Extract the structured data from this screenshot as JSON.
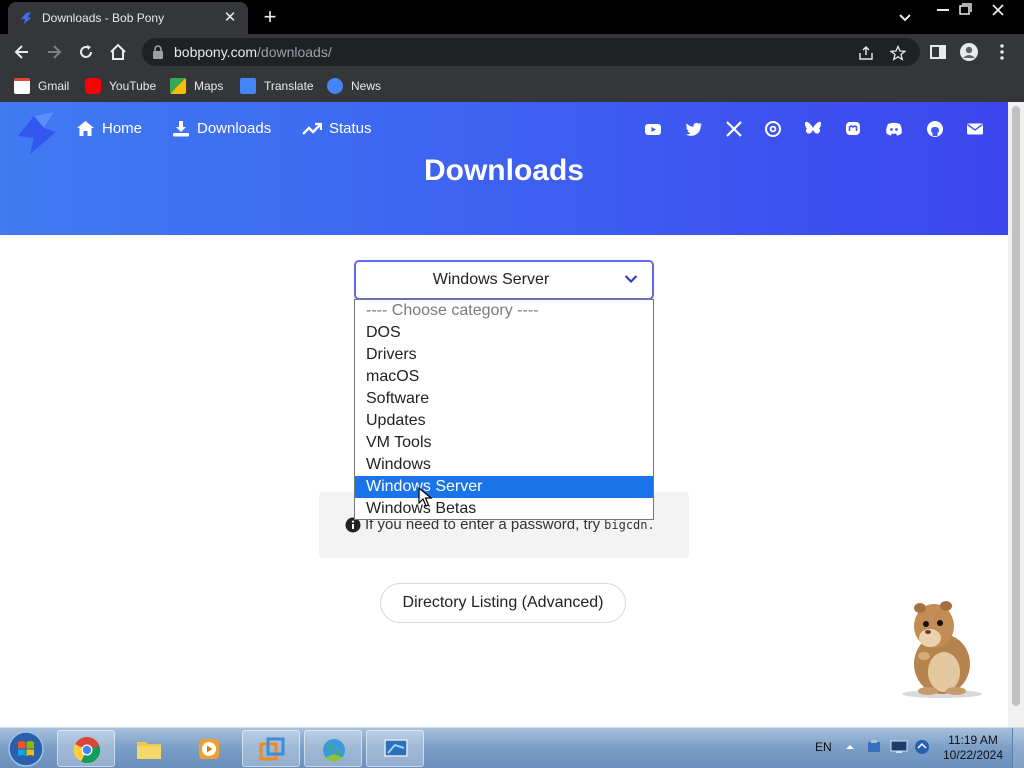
{
  "browser": {
    "tab_title": "Downloads - Bob Pony",
    "url_domain": "bobpony.com",
    "url_path": "/downloads/",
    "bookmarks": [
      "Gmail",
      "YouTube",
      "Maps",
      "Translate",
      "News"
    ]
  },
  "site": {
    "nav": {
      "home": "Home",
      "downloads": "Downloads",
      "status": "Status"
    },
    "social_icons": [
      "youtube-icon",
      "twitter-icon",
      "x-icon",
      "threads-icon",
      "bluesky-icon",
      "mastodon-icon",
      "discord-icon",
      "github-icon",
      "email-icon"
    ],
    "title": "Downloads",
    "select": {
      "value": "Windows Server",
      "options": [
        "---- Choose category ----",
        "DOS",
        "Drivers",
        "macOS",
        "Software",
        "Updates",
        "VM Tools",
        "Windows",
        "Windows Server",
        "Windows Betas"
      ],
      "selected_index": 8
    },
    "info_text": "If you need to enter a password, try",
    "info_code": "bigcdn.",
    "directory_button": "Directory Listing (Advanced)"
  },
  "taskbar": {
    "language": "EN",
    "time": "11:19 AM",
    "date": "10/22/2024"
  },
  "colors": {
    "hero_start": "#3f7bf2",
    "hero_end": "#3c45ee",
    "selected_option": "#1a73e8"
  }
}
